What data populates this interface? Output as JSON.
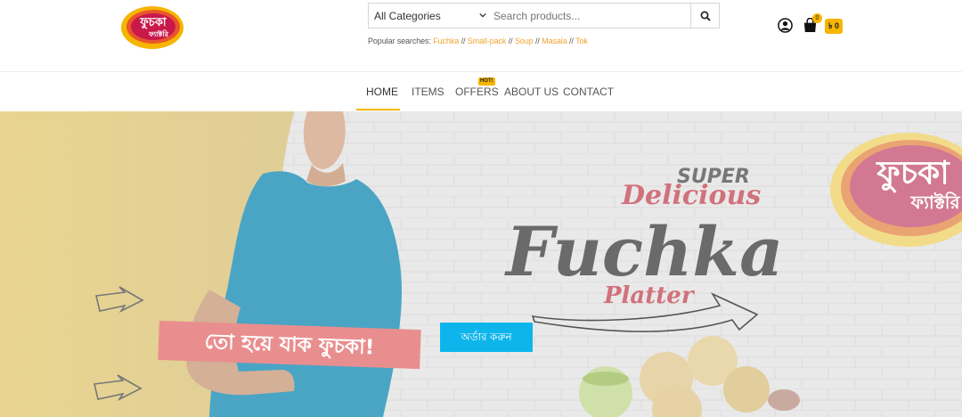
{
  "header": {
    "logo_alt": "ফুচকা ফ্যাক্টরি",
    "category_select": {
      "selected": "All Categories"
    },
    "search": {
      "placeholder": "Search products..."
    },
    "popular": {
      "label": "Popular searches:",
      "terms": [
        "Fuchka",
        "Small-pack",
        "Soup",
        "Masala",
        "Tok"
      ],
      "separator": "//"
    },
    "cart": {
      "count": "0",
      "total": "৳ 0"
    }
  },
  "nav": {
    "items": [
      {
        "label": "HOME",
        "active": true
      },
      {
        "label": "ITEMS",
        "active": false
      },
      {
        "label": "OFFERS",
        "active": false,
        "badge": "HOT!"
      },
      {
        "label": "ABOUT US",
        "active": false
      },
      {
        "label": "CONTACT",
        "active": false
      }
    ]
  },
  "hero": {
    "super": "SUPER",
    "delicious": "Delicious",
    "fuchka": "Fuchka",
    "platter": "Platter",
    "slogan": "তো হয়ে যাক ফুচকা!",
    "order_button": "অর্ডার করুন",
    "badge_line1": "ফুচকা",
    "badge_line2": "ফ্যাক্টরি"
  },
  "colors": {
    "accent": "#f6b500",
    "link": "#f0a330",
    "cta": "#0eb5ec",
    "slogan_banner": "#e98e8e"
  }
}
